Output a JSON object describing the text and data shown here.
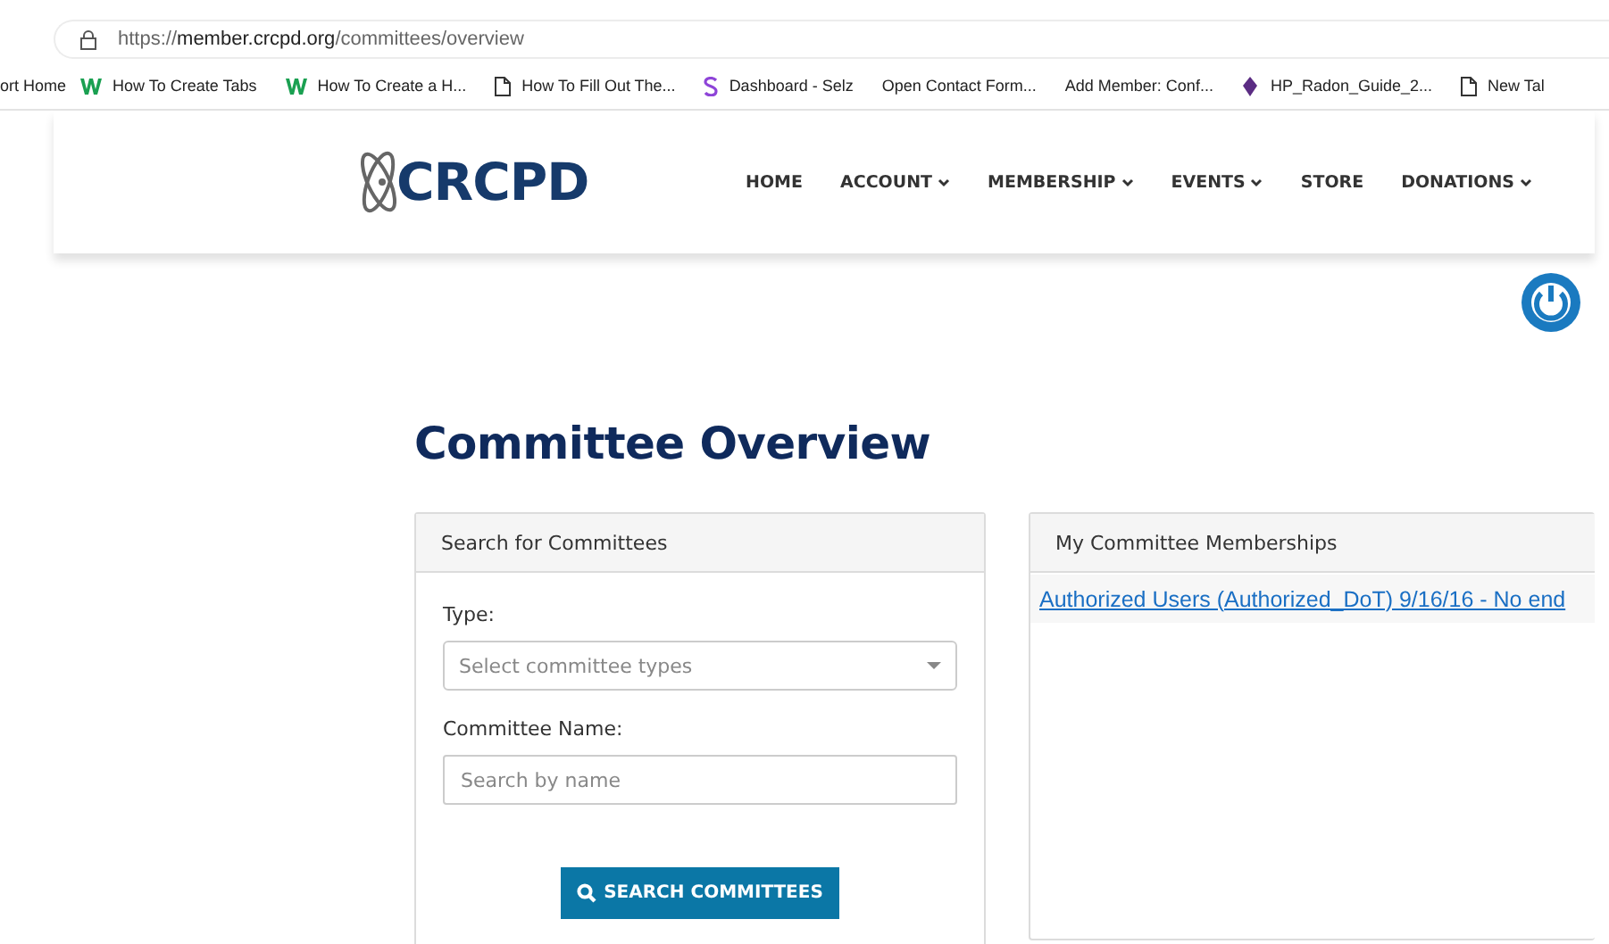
{
  "browser": {
    "url": "https://**member.crcpd.org**/committees/overview",
    "bookmarks": [
      {
        "label": "ort Home",
        "kind": "none"
      },
      {
        "label": "How To Create Tabs",
        "kind": "w"
      },
      {
        "label": "How To Create a H...",
        "kind": "w"
      },
      {
        "label": "How To Fill Out The...",
        "kind": "doc"
      },
      {
        "label": "Dashboard - Selz",
        "kind": "s"
      },
      {
        "label": "Open Contact Form...",
        "kind": "none"
      },
      {
        "label": "Add Member: Conf...",
        "kind": "none"
      },
      {
        "label": "HP_Radon_Guide_2...",
        "kind": "drop"
      },
      {
        "label": "New Tal",
        "kind": "doc"
      }
    ]
  },
  "header": {
    "logo": "CRCPD",
    "nav": [
      {
        "label": "HOME",
        "has_menu": false
      },
      {
        "label": "ACCOUNT",
        "has_menu": true
      },
      {
        "label": "MEMBERSHIP",
        "has_menu": true
      },
      {
        "label": "EVENTS",
        "has_menu": true
      },
      {
        "label": "STORE",
        "has_menu": false
      },
      {
        "label": "DONATIONS",
        "has_menu": true
      }
    ]
  },
  "title": "Committee Overview",
  "search_panel": {
    "title": "Search for Committees",
    "type_label": "Type:",
    "type_select": {
      "placeholder": "Select committee types"
    },
    "name_label": "Committee Name:",
    "name_field": {
      "placeholder": "Search by name"
    },
    "button": "SEARCH COMMITTEES"
  },
  "memberships_panel": {
    "title": "My Committee Memberships",
    "items": [
      "Authorized Users (Authorized_DoT) 9/16/16 - No end"
    ]
  }
}
